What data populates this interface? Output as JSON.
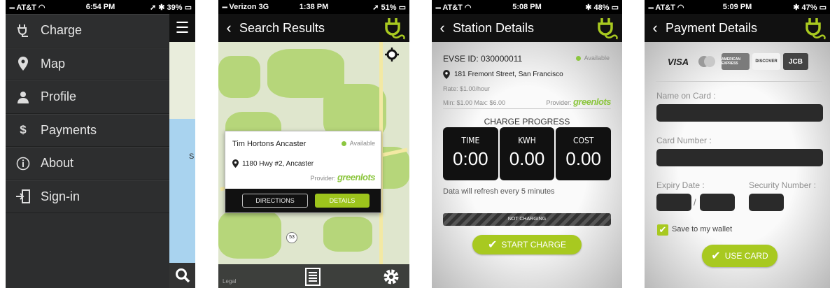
{
  "phone1": {
    "status": {
      "carrier": "AT&T",
      "time": "6:54 PM",
      "battery": "39%"
    },
    "menu": [
      {
        "label": "Charge",
        "icon": "plug-icon"
      },
      {
        "label": "Map",
        "icon": "map-pin-icon"
      },
      {
        "label": "Profile",
        "icon": "person-icon"
      },
      {
        "label": "Payments",
        "icon": "dollar-icon"
      },
      {
        "label": "About",
        "icon": "info-icon"
      },
      {
        "label": "Sign-in",
        "icon": "sign-in-icon"
      }
    ],
    "map_letter": "S"
  },
  "phone2": {
    "status": {
      "carrier": "Verizon",
      "network": "3G",
      "time": "1:38 PM",
      "battery": "51%"
    },
    "title": "Search Results",
    "popup": {
      "name": "Tim Hortons Ancaster",
      "availability": "Available",
      "address": "1180 Hwy #2, Ancaster",
      "provider_label": "Provider:",
      "provider": "greenlots",
      "directions": "DIRECTIONS",
      "details": "DETAILS"
    },
    "route_marker": "53",
    "map_legal": "Legal"
  },
  "phone3": {
    "status": {
      "carrier": "AT&T",
      "time": "5:08 PM",
      "battery": "48%"
    },
    "title": "Station Details",
    "evse": "EVSE ID: 030000011",
    "availability": "Available",
    "address": "181 Fremont Street, San Francisco",
    "rate": "Rate: $1.00/hour",
    "minmax": "Min: $1.00 Max: $6.00",
    "provider_label": "Provider:",
    "provider": "greenlots",
    "progress_title": "CHARGE PROGRESS",
    "tiles": [
      {
        "label": "TIME",
        "value": "0:00"
      },
      {
        "label": "KWH",
        "value": "0.00"
      },
      {
        "label": "COST",
        "value": "0.00"
      }
    ],
    "refresh_note": "Data will refresh every 5 minutes",
    "charge_state": "NOT CHARGING",
    "start_button": "START CHARGE"
  },
  "phone4": {
    "status": {
      "carrier": "AT&T",
      "time": "5:09 PM",
      "battery": "47%"
    },
    "title": "Payment Details",
    "cards": [
      "VISA",
      "",
      "AMERICAN EXPRESS",
      "DISCOVER",
      "JCB"
    ],
    "name_label": "Name on Card :",
    "number_label": "Card Number :",
    "expiry_label": "Expiry Date :",
    "expiry_separator": "/",
    "security_label": "Security Number :",
    "save_label": "Save to my wallet",
    "use_button": "USE CARD"
  },
  "colors": {
    "accent": "#a8c920",
    "dark": "#111111",
    "available": "#8cc63f"
  }
}
